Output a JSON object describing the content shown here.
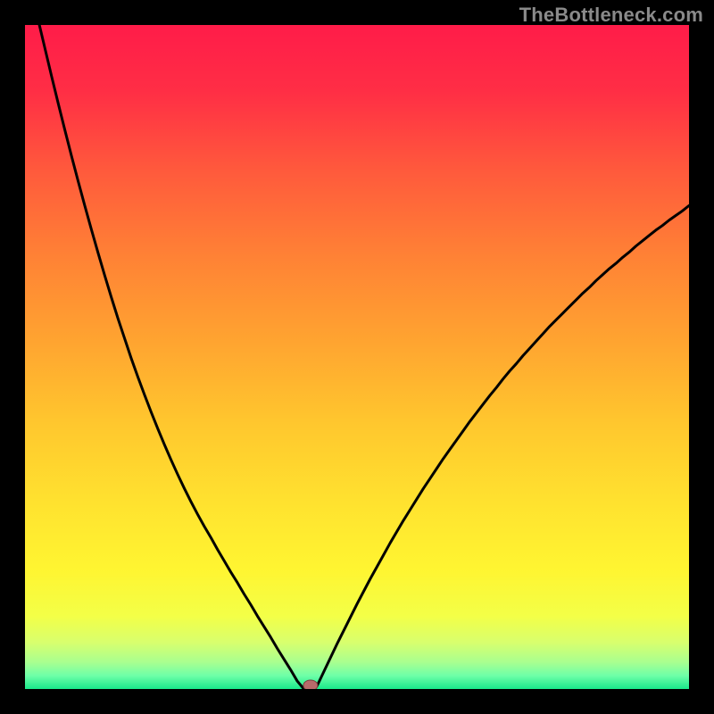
{
  "watermark": "TheBottleneck.com",
  "chart_data": {
    "type": "line",
    "title": "",
    "xlabel": "",
    "ylabel": "",
    "xlim": [
      0,
      100
    ],
    "ylim": [
      0,
      100
    ],
    "grid": false,
    "background_gradient_note": "smooth vertical gradient: red at top through orange and yellow to green at bottom",
    "minimum_marker": {
      "x": 43,
      "y": 0
    },
    "x": [
      0,
      1,
      2,
      3,
      4,
      5,
      6,
      7,
      8,
      9,
      10,
      11,
      12,
      13,
      14,
      15,
      16,
      17,
      18,
      19,
      20,
      21,
      22,
      23,
      24,
      25,
      26,
      27,
      28,
      29,
      30,
      31,
      32,
      33,
      34,
      35,
      36,
      37,
      38,
      39,
      40,
      41,
      42,
      42.5,
      43,
      43.5,
      44,
      45,
      46,
      47,
      48,
      49,
      50,
      51,
      52,
      53,
      54,
      55,
      56,
      57,
      58,
      59,
      60,
      61,
      62,
      63,
      64,
      65,
      66,
      67,
      68,
      69,
      70,
      71,
      72,
      73,
      74,
      75,
      76,
      77,
      78,
      79,
      80,
      81,
      82,
      83,
      84,
      85,
      86,
      87,
      88,
      89,
      90,
      91,
      92,
      93,
      94,
      95,
      96,
      97,
      98,
      99,
      100
    ],
    "values": [
      109.4,
      105.0,
      100.7,
      96.5,
      92.3,
      88.2,
      84.2,
      80.3,
      76.5,
      72.8,
      69.2,
      65.7,
      62.3,
      59.0,
      55.8,
      52.8,
      49.8,
      47.0,
      44.3,
      41.7,
      39.2,
      36.8,
      34.5,
      32.3,
      30.2,
      28.2,
      26.3,
      24.5,
      22.8,
      21.0,
      19.3,
      17.6,
      16.0,
      14.3,
      12.7,
      11.0,
      9.4,
      7.8,
      6.1,
      4.5,
      2.9,
      1.2,
      0.0,
      0.0,
      0.0,
      0.0,
      0.5,
      2.6,
      4.7,
      6.8,
      8.8,
      10.8,
      12.8,
      14.7,
      16.6,
      18.4,
      20.2,
      22.0,
      23.7,
      25.4,
      27.0,
      28.6,
      30.2,
      31.7,
      33.2,
      34.7,
      36.1,
      37.5,
      38.9,
      40.3,
      41.6,
      42.9,
      44.2,
      45.4,
      46.7,
      47.9,
      49.0,
      50.2,
      51.3,
      52.4,
      53.5,
      54.6,
      55.6,
      56.6,
      57.6,
      58.6,
      59.6,
      60.5,
      61.5,
      62.4,
      63.3,
      64.1,
      65.0,
      65.8,
      66.7,
      67.5,
      68.3,
      69.1,
      69.8,
      70.6,
      71.3,
      72.0,
      72.8
    ]
  },
  "colors": {
    "curve": "#000000",
    "marker_fill": "#b86a6a",
    "marker_stroke": "#7a3d3d"
  }
}
